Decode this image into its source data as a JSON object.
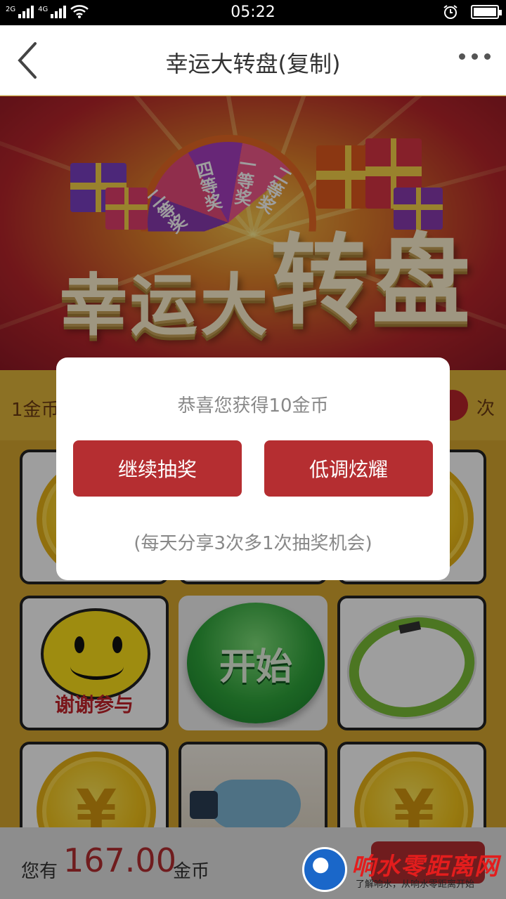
{
  "status_bar": {
    "network_1": "2G",
    "network_2": "4G",
    "time": "05:22",
    "icons": [
      "signal-icon",
      "wifi-icon",
      "alarm-icon",
      "battery-icon"
    ]
  },
  "nav": {
    "title": "幸运大转盘(复制)",
    "back_icon": "chevron-left-icon",
    "more_icon": "more-dots-icon"
  },
  "banner": {
    "title_small": "幸运大",
    "title_big": "转盘",
    "wheel_labels": [
      "二等奖",
      "四等奖",
      "一等奖",
      "二等奖"
    ]
  },
  "info": {
    "cost_text": "1金币",
    "times_suffix": "次"
  },
  "grid": {
    "thanks_label": "谢谢参与",
    "start_label": "开始",
    "coin_symbol": "¥"
  },
  "dialog": {
    "message": "恭喜您获得10金币",
    "continue_label": "继续抽奖",
    "show_off_label": "低调炫耀",
    "note": "(每天分享3次多1次抽奖机会)"
  },
  "balance": {
    "label": "您有",
    "value": "167.00",
    "unit": "金币"
  },
  "watermark": {
    "title": "响水零距离网",
    "subtitle": "了解响水，从响水零距离开始"
  },
  "colors": {
    "accent_red": "#b52e31",
    "background_gold": "#d9a92f"
  }
}
